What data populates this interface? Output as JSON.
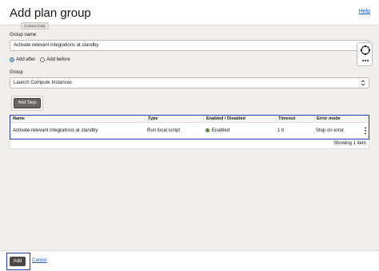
{
  "header": {
    "title": "Add plan group",
    "help": "Help"
  },
  "tooltip": "Content body",
  "group_name": {
    "label": "Group name",
    "value": "Activate relevant integrations at standby"
  },
  "position": {
    "options": [
      "Add after",
      "Add before"
    ],
    "selected": "Add after"
  },
  "group": {
    "label": "Group",
    "value": "Launch Compute Instances"
  },
  "add_step_label": "Add Step",
  "table": {
    "columns": [
      "Name",
      "Type",
      "Enabled / Disabled",
      "Timeout",
      "Error mode"
    ],
    "rows": [
      {
        "name": "Activate relevant integrations at standby",
        "type": "Run local script",
        "enabled": "Enabled",
        "timeout": "1 h",
        "error_mode": "Stop on error"
      }
    ],
    "status_color": "#4f8a3c",
    "footer": "Showing 1 item"
  },
  "footer": {
    "add": "Add",
    "cancel": "Cancel"
  },
  "colors": {
    "accent": "#1a5bb5",
    "highlight_border": "#1f3fb0"
  }
}
